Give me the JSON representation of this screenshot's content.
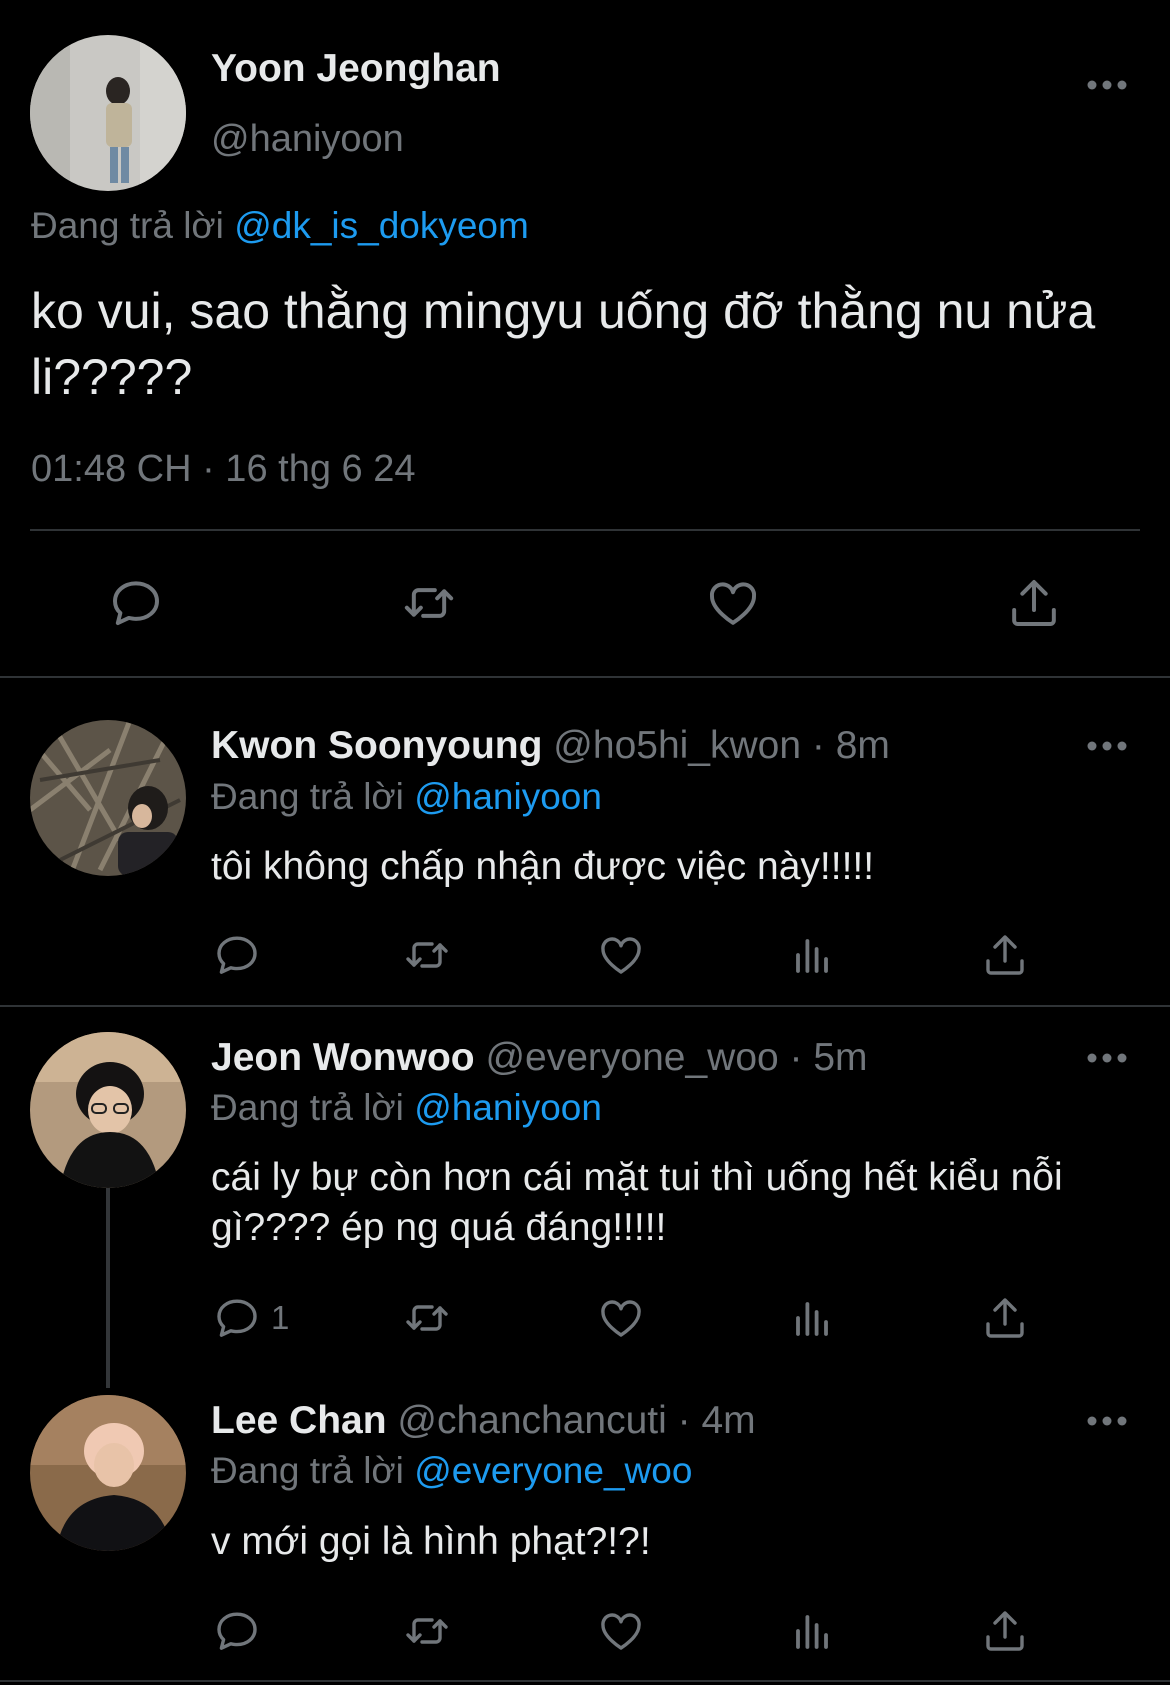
{
  "main_tweet": {
    "name": "Yoon Jeonghan",
    "handle": "@haniyoon",
    "reply_prefix": "Đang trả lời",
    "reply_to": "@dk_is_dokyeom",
    "text": "ko vui, sao thằng mingyu uống đỡ thằng nu nửa li?????",
    "timestamp": "01:48 CH · 16 thg 6 24",
    "actions": [
      "reply-icon",
      "retweet-icon",
      "like-icon",
      "share-icon"
    ]
  },
  "replies": [
    {
      "name": "Kwon Soonyoung",
      "handle_time": "@ho5hi_kwon · 8m",
      "reply_prefix": "Đang trả lời",
      "reply_to": "@haniyoon",
      "text": "tôi không chấp nhận được việc này!!!!!",
      "reply_count": ""
    },
    {
      "name": "Jeon Wonwoo",
      "handle_time": "@everyone_woo · 5m",
      "reply_prefix": "Đang trả lời",
      "reply_to": "@haniyoon",
      "text": "cái ly bự còn hơn cái mặt tui thì uống hết kiểu nỗi gì???? ép ng quá đáng!!!!!",
      "reply_count": "1"
    },
    {
      "name": "Lee Chan",
      "handle_time": "@chanchancuti · 4m",
      "reply_prefix": "Đang trả lời",
      "reply_to": "@everyone_woo",
      "text": "v mới gọi là hình phạt?!?!",
      "reply_count": ""
    }
  ],
  "colors": {
    "background": "#000000",
    "text": "#e7e9ea",
    "muted": "#71767b",
    "link": "#1d9bf0",
    "divider": "#2f3336"
  }
}
